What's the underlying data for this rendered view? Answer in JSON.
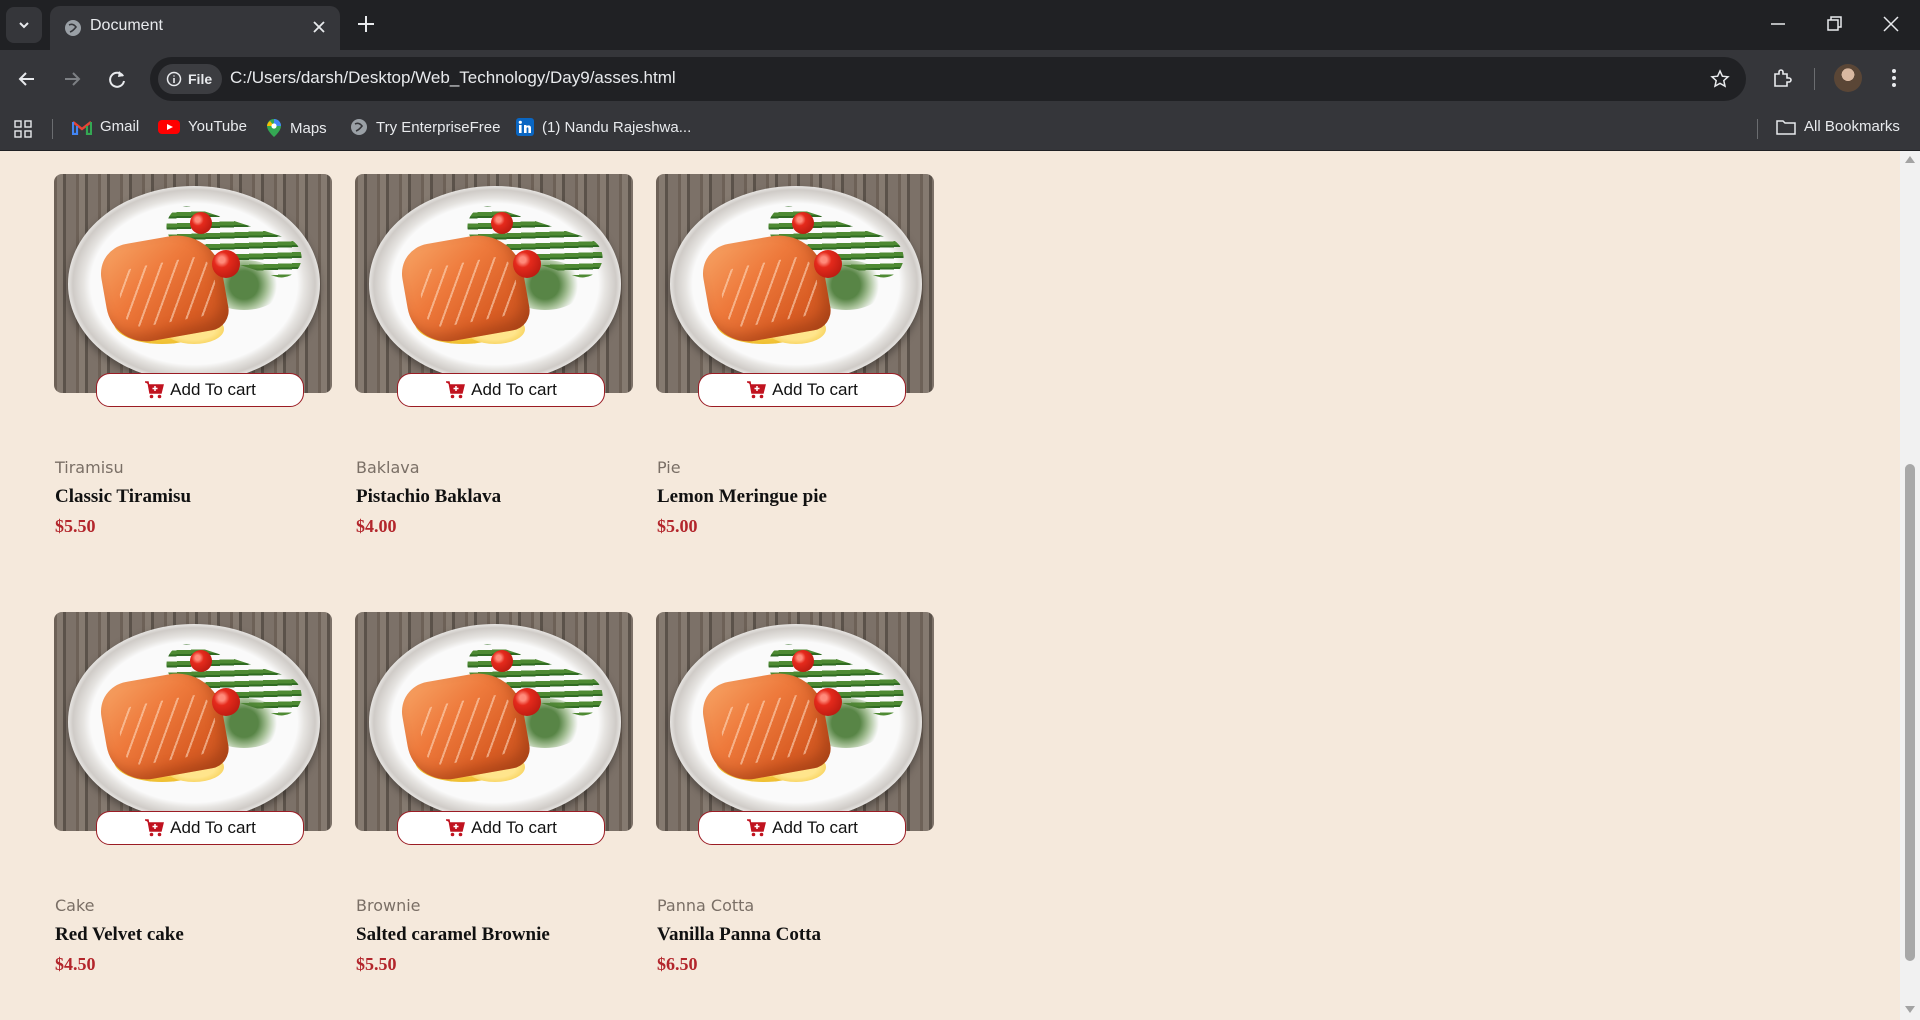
{
  "browser": {
    "tab_title": "Document",
    "file_chip": "File",
    "url": "C:/Users/darsh/Desktop/Web_Technology/Day9/asses.html",
    "bookmarks": [
      {
        "label": "Gmail",
        "icon": "gmail-icon"
      },
      {
        "label": "YouTube",
        "icon": "youtube-icon"
      },
      {
        "label": "Maps",
        "icon": "maps-icon"
      },
      {
        "label": "Try EnterpriseFree",
        "icon": "globe-icon"
      },
      {
        "label": "(1) Nandu Rajeshwa...",
        "icon": "linkedin-icon"
      }
    ],
    "all_bookmarks": "All Bookmarks"
  },
  "products": [
    {
      "category": "Tiramisu",
      "name": "Classic Tiramisu",
      "price": "$5.50",
      "button": "Add To cart"
    },
    {
      "category": "Baklava",
      "name": "Pistachio Baklava",
      "price": "$4.00",
      "button": "Add To cart"
    },
    {
      "category": "Pie",
      "name": "Lemon Meringue pie",
      "price": "$5.00",
      "button": "Add To cart"
    },
    {
      "category": "Cake",
      "name": "Red Velvet cake",
      "price": "$4.50",
      "button": "Add To cart"
    },
    {
      "category": "Brownie",
      "name": "Salted caramel Brownie",
      "price": "$5.50",
      "button": "Add To cart"
    },
    {
      "category": "Panna Cotta",
      "name": "Vanilla Panna Cotta",
      "price": "$6.50",
      "button": "Add To cart"
    }
  ],
  "colors": {
    "page_background": "#f5e9dc",
    "price": "#b3262c",
    "button_border": "#9b1c24",
    "chrome_dark": "#202124",
    "chrome_mid": "#35363a"
  }
}
